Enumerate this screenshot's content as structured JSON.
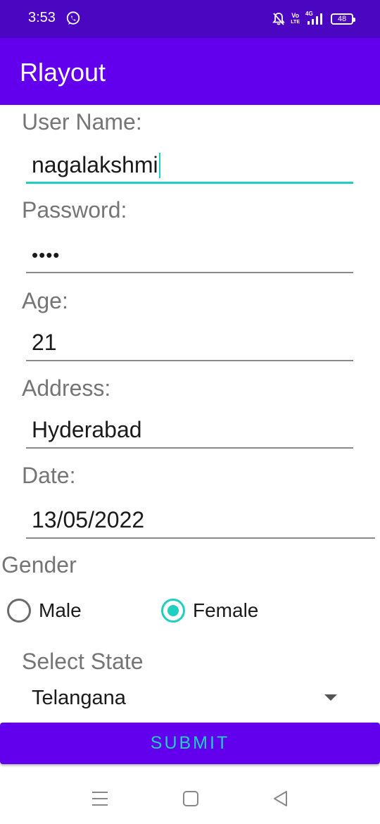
{
  "status_bar": {
    "time": "3:53",
    "network_top": "Vo",
    "network_bottom": "LTE",
    "signal": "4G",
    "battery": "48"
  },
  "app_bar": {
    "title": "Rlayout"
  },
  "form": {
    "username": {
      "label": "User Name:",
      "value": "nagalakshmi"
    },
    "password": {
      "label": "Password:",
      "value": "••••"
    },
    "age": {
      "label": "Age:",
      "value": "21"
    },
    "address": {
      "label": "Address:",
      "value": "Hyderabad"
    },
    "date": {
      "label": "Date:",
      "value": "13/05/2022"
    },
    "gender": {
      "label": "Gender",
      "options": [
        {
          "label": "Male",
          "checked": false
        },
        {
          "label": "Female",
          "checked": true
        }
      ]
    },
    "state": {
      "label": "Select State",
      "value": "Telangana"
    },
    "submit_label": "SUBMIT"
  },
  "colors": {
    "status_bar": "#4a06c0",
    "primary": "#6200ee",
    "accent": "#1fcfbf"
  },
  "nav_icons": [
    "menu-icon",
    "home-icon",
    "back-icon"
  ]
}
